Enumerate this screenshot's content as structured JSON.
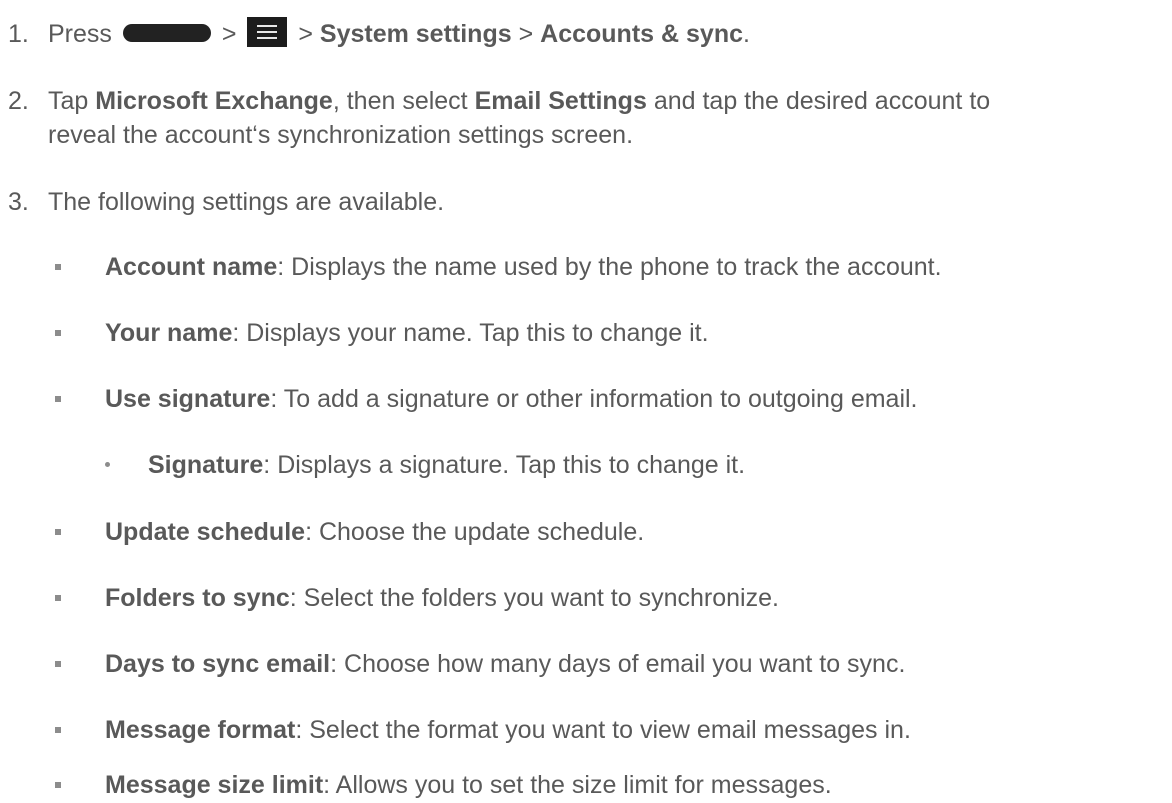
{
  "steps": [
    {
      "number": "1.",
      "press": "Press",
      "sep": ">",
      "home_button_icon": "home-button-icon",
      "menu_button_icon": "menu-icon",
      "item1": "System settings",
      "item2": "Accounts & sync",
      "end": "."
    },
    {
      "number": "2.",
      "pre": "Tap",
      "b1": "Microsoft Exchange",
      "mid": ", then select",
      "b2": "Email Settings",
      "post_line1": "and tap the desired account to",
      "line2": "reveal the account‘s synchronization settings screen."
    },
    {
      "number": "3.",
      "text": "The following settings are available."
    }
  ],
  "settings": [
    {
      "term": "Account name",
      "desc": ": Displays the name used by the phone to track the account."
    },
    {
      "term": "Your name",
      "desc": ": Displays your name. Tap this to change it."
    },
    {
      "term": "Use signature",
      "desc": ": To add a signature or other information to outgoing email."
    },
    {
      "term": "Signature",
      "desc": ": Displays a signature. Tap this to change it.",
      "sub": true
    },
    {
      "term": "Update schedule",
      "desc": ": Choose the update schedule."
    },
    {
      "term": "Folders to sync",
      "desc": ": Select the folders you want to synchronize."
    },
    {
      "term": "Days to sync email",
      "desc": ": Choose how many days of email you want to sync."
    },
    {
      "term": "Message format",
      "desc": ": Select the format you want to view email messages in."
    },
    {
      "term": "Message size limit",
      "desc": ": Allows you to set the size limit for messages."
    }
  ]
}
